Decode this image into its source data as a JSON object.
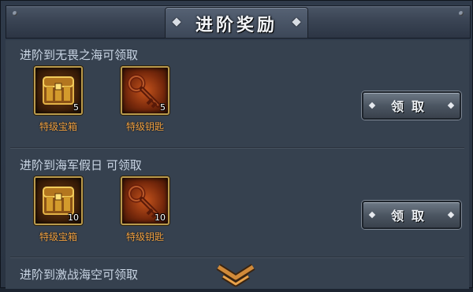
{
  "header": {
    "title": "进阶奖励"
  },
  "sections": [
    {
      "title": "进阶到无畏之海可领取",
      "items": [
        {
          "name": "特级宝箱",
          "qty": "5",
          "icon": "treasure-chest-icon"
        },
        {
          "name": "特级钥匙",
          "qty": "5",
          "icon": "key-icon"
        }
      ],
      "button": "领取"
    },
    {
      "title": "进阶到海军假日 可领取",
      "items": [
        {
          "name": "特级宝箱",
          "qty": "10",
          "icon": "treasure-chest-icon"
        },
        {
          "name": "特级钥匙",
          "qty": "10",
          "icon": "key-icon"
        }
      ],
      "button": "领取"
    },
    {
      "title": "进阶到激战海空可领取"
    }
  ],
  "colors": {
    "accent_orange": "#f0a040",
    "title_text": "#c9d5e4",
    "panel_bg": "#36414f",
    "icon_border": "#b99a4c"
  },
  "scroll_indicator": "chevron-down-icon"
}
